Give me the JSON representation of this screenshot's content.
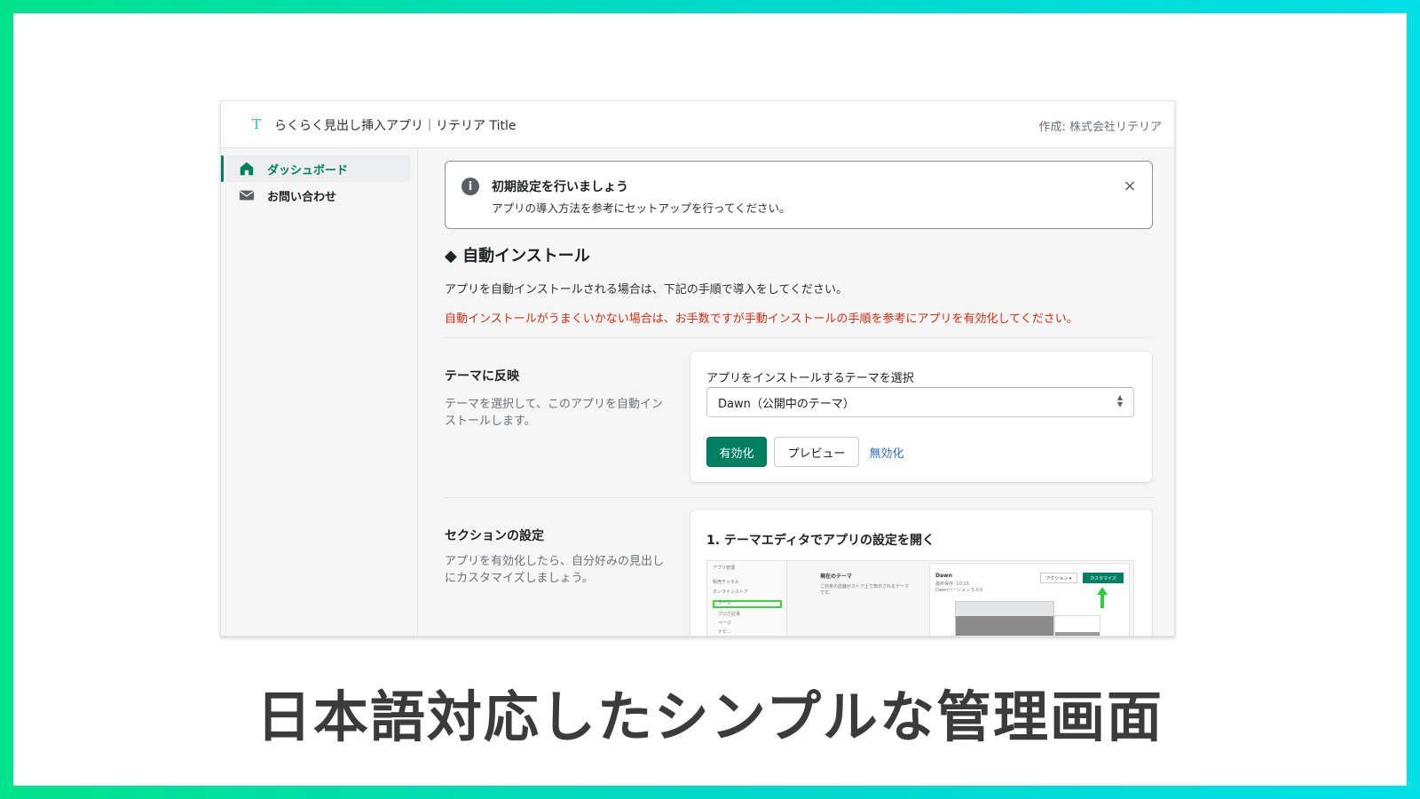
{
  "app": {
    "logo_letter": "T",
    "title": "らくらく見出し挿入アプリ｜リテリア Title",
    "author": "作成: 株式会社リテリア"
  },
  "sidebar": {
    "items": [
      {
        "label": "ダッシュボード",
        "icon": "home-icon",
        "active": true
      },
      {
        "label": "お問い合わせ",
        "icon": "mail-icon",
        "active": false
      }
    ]
  },
  "banner": {
    "icon": "info-icon",
    "title": "初期設定を行いましょう",
    "text": "アプリの導入方法を参考にセットアップを行ってください。",
    "close_icon": "×"
  },
  "auto_install": {
    "heading": "◆ 自動インストール",
    "description": "アプリを自動インストールされる場合は、下記の手順で導入をしてください。",
    "warning": "自動インストールがうまくいかない場合は、お手数ですが手動インストールの手順を参考にアプリを有効化してください。",
    "warning_color": "#d72c0d"
  },
  "theme_section": {
    "title": "テーマに反映",
    "description": "テーマを選択して、このアプリを自動インストールします。",
    "select_label": "アプリをインストールするテーマを選択",
    "select_value": "Dawn（公開中のテーマ）",
    "enable_button": "有効化",
    "preview_button": "プレビュー",
    "disable_button": "無効化",
    "primary_color": "#008060"
  },
  "section_settings": {
    "title": "セクションの設定",
    "description": "アプリを有効化したら、自分好みの見出しにカスタマイズしましょう。",
    "step_title": "1. テーマエディタでアプリの設定を開く",
    "screenshot": {
      "side_header": "アプリ管理",
      "side_items": [
        "販売チャネル",
        "オンラインストア",
        "テーマ",
        "ブログ記事",
        "ページ",
        "ナビ..."
      ],
      "mid_title": "現在のテーマ",
      "mid_text": "ご自身の店舗がストア上で表示されるテーマです。",
      "theme_name": "Dawn",
      "theme_meta": "最終保存: 10:13",
      "theme_version": "Dawnバージョン 5.0.0",
      "actions_button": "アクション ▾",
      "customize_button": "カスタマイズ"
    }
  },
  "caption": "日本語対応したシンプルな管理画面"
}
